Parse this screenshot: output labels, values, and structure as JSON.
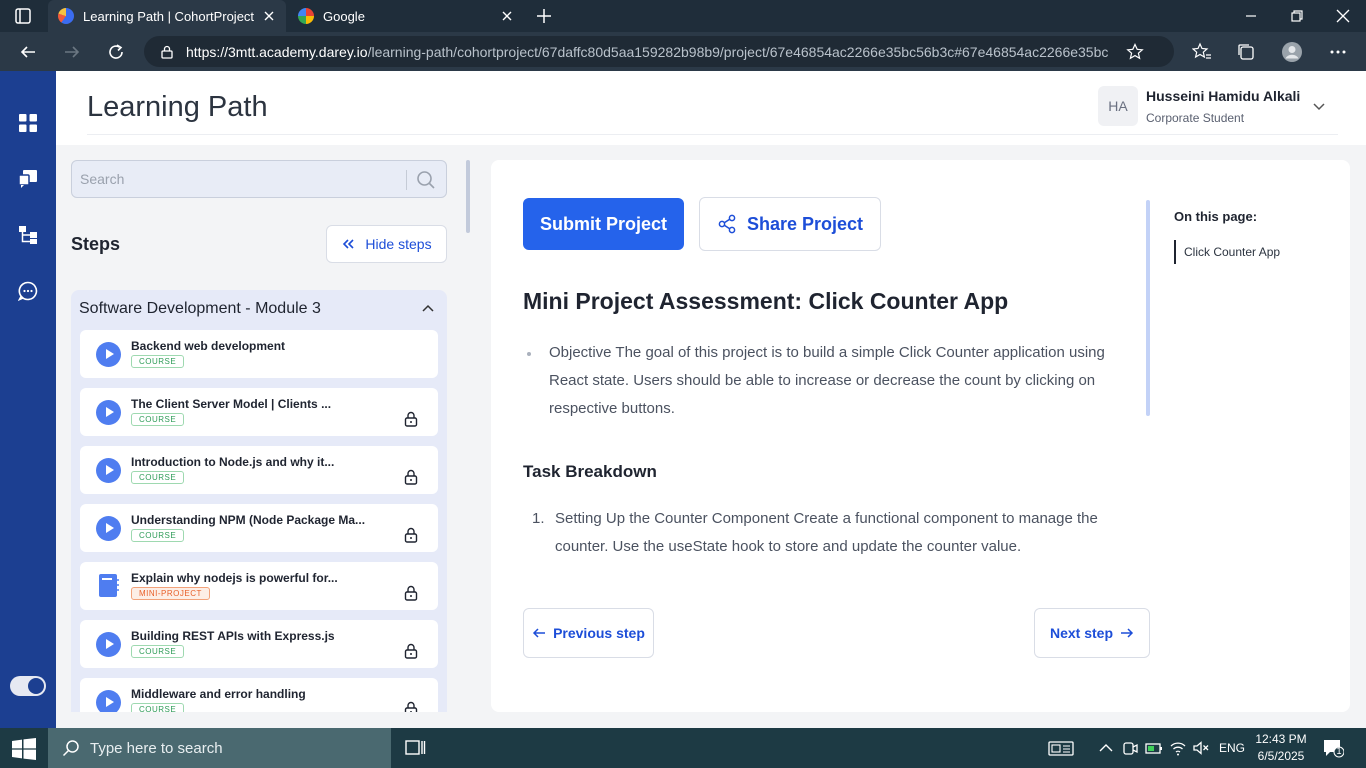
{
  "browser": {
    "tabs": [
      {
        "title": "Learning Path | CohortProject | D",
        "active": true,
        "favicon": "darey-icon"
      },
      {
        "title": "Google",
        "active": false,
        "favicon": "google-icon"
      }
    ],
    "url_host": "https://3mtt.academy.darey.io",
    "url_path": "/learning-path/cohortproject/67daffc80d5aa159282b98b9/project/67e46854ac2266e35bc56b3c#67e46854ac2266e35bc..."
  },
  "header": {
    "title": "Learning Path",
    "user_initials": "HA",
    "user_name": "Husseini Hamidu Alkali",
    "user_role": "Corporate Student"
  },
  "sidebar": {
    "search_placeholder": "Search",
    "steps_heading": "Steps",
    "hide_steps_label": "Hide steps",
    "module_title": "Software Development - Module 3",
    "steps": [
      {
        "title": "Backend web development",
        "badge": "COURSE",
        "type": "course",
        "locked": false
      },
      {
        "title": "The Client Server Model | Clients ...",
        "badge": "COURSE",
        "type": "course",
        "locked": true
      },
      {
        "title": "Introduction to Node.js and why it...",
        "badge": "COURSE",
        "type": "course",
        "locked": true
      },
      {
        "title": "Understanding NPM (Node Package Ma...",
        "badge": "COURSE",
        "type": "course",
        "locked": true
      },
      {
        "title": "Explain why nodejs is powerful for...",
        "badge": "MINI-PROJECT",
        "type": "mini",
        "locked": true
      },
      {
        "title": "Building REST APIs with Express.js",
        "badge": "COURSE",
        "type": "course",
        "locked": true
      },
      {
        "title": "Middleware and error handling",
        "badge": "COURSE",
        "type": "course",
        "locked": true
      }
    ]
  },
  "main": {
    "submit_label": "Submit Project",
    "share_label": "Share Project",
    "project_title": "Mini Project Assessment: Click Counter App",
    "objective": "Objective The goal of this project is to build a simple Click Counter application using React state. Users should be able to increase or decrease the count by clicking on respective buttons.",
    "task_heading": "Task Breakdown",
    "task_number": "1.",
    "task_text": "Setting Up the Counter Component Create a functional component to manage the counter. Use the useState hook to store and update the counter value.",
    "prev_label": "Previous step",
    "next_label": "Next step",
    "toc_heading": "On this page:",
    "toc_item": "Click Counter App"
  },
  "taskbar": {
    "search_placeholder": "Type here to search",
    "language": "ENG",
    "time": "12:43 PM",
    "date": "6/5/2025",
    "notification_count": "1"
  },
  "colors": {
    "rail": "#1c3f91",
    "primary": "#2563eb",
    "module_bg": "#e6eaf8",
    "course_badge": "#2f9c58",
    "mini_badge": "#e8602a"
  }
}
